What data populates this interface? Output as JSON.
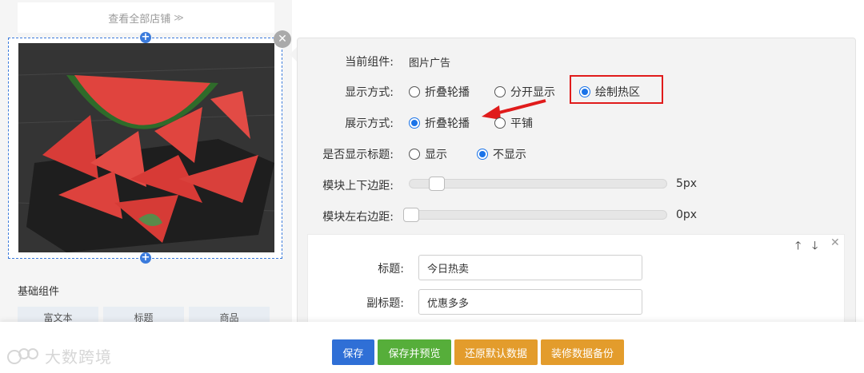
{
  "left": {
    "view_all": "查看全部店铺",
    "basic_title": "基础组件",
    "components": [
      "富文本",
      "标题",
      "商品"
    ]
  },
  "panel": {
    "current_label": "当前组件:",
    "current_value": "图片广告",
    "display_mode_label": "显示方式:",
    "display_mode_options": [
      "折叠轮播",
      "分开显示",
      "绘制热区"
    ],
    "display_mode_selected": "绘制热区",
    "show_mode_label": "展示方式:",
    "show_mode_options": [
      "折叠轮播",
      "平铺"
    ],
    "show_mode_selected": "折叠轮播",
    "show_title_label": "是否显示标题:",
    "show_title_options": [
      "显示",
      "不显示"
    ],
    "show_title_selected": "不显示",
    "vpad_label": "模块上下边距:",
    "vpad_value": "5px",
    "hpad_label": "模块左右边距:",
    "hpad_value": "0px",
    "title_label": "标题:",
    "title_value": "今日热卖",
    "subtitle_label": "副标题:",
    "subtitle_value": "优惠多多"
  },
  "buttons": {
    "save": "保存",
    "save_preview": "保存并预览",
    "restore": "还原默认数据",
    "backup": "装修数据备份"
  },
  "colors": {
    "save": "#2f6fd6",
    "save_preview": "#56ae3a",
    "orange": "#e39c2c",
    "highlight": "#e01b1b"
  },
  "watermark": "大数跨境"
}
